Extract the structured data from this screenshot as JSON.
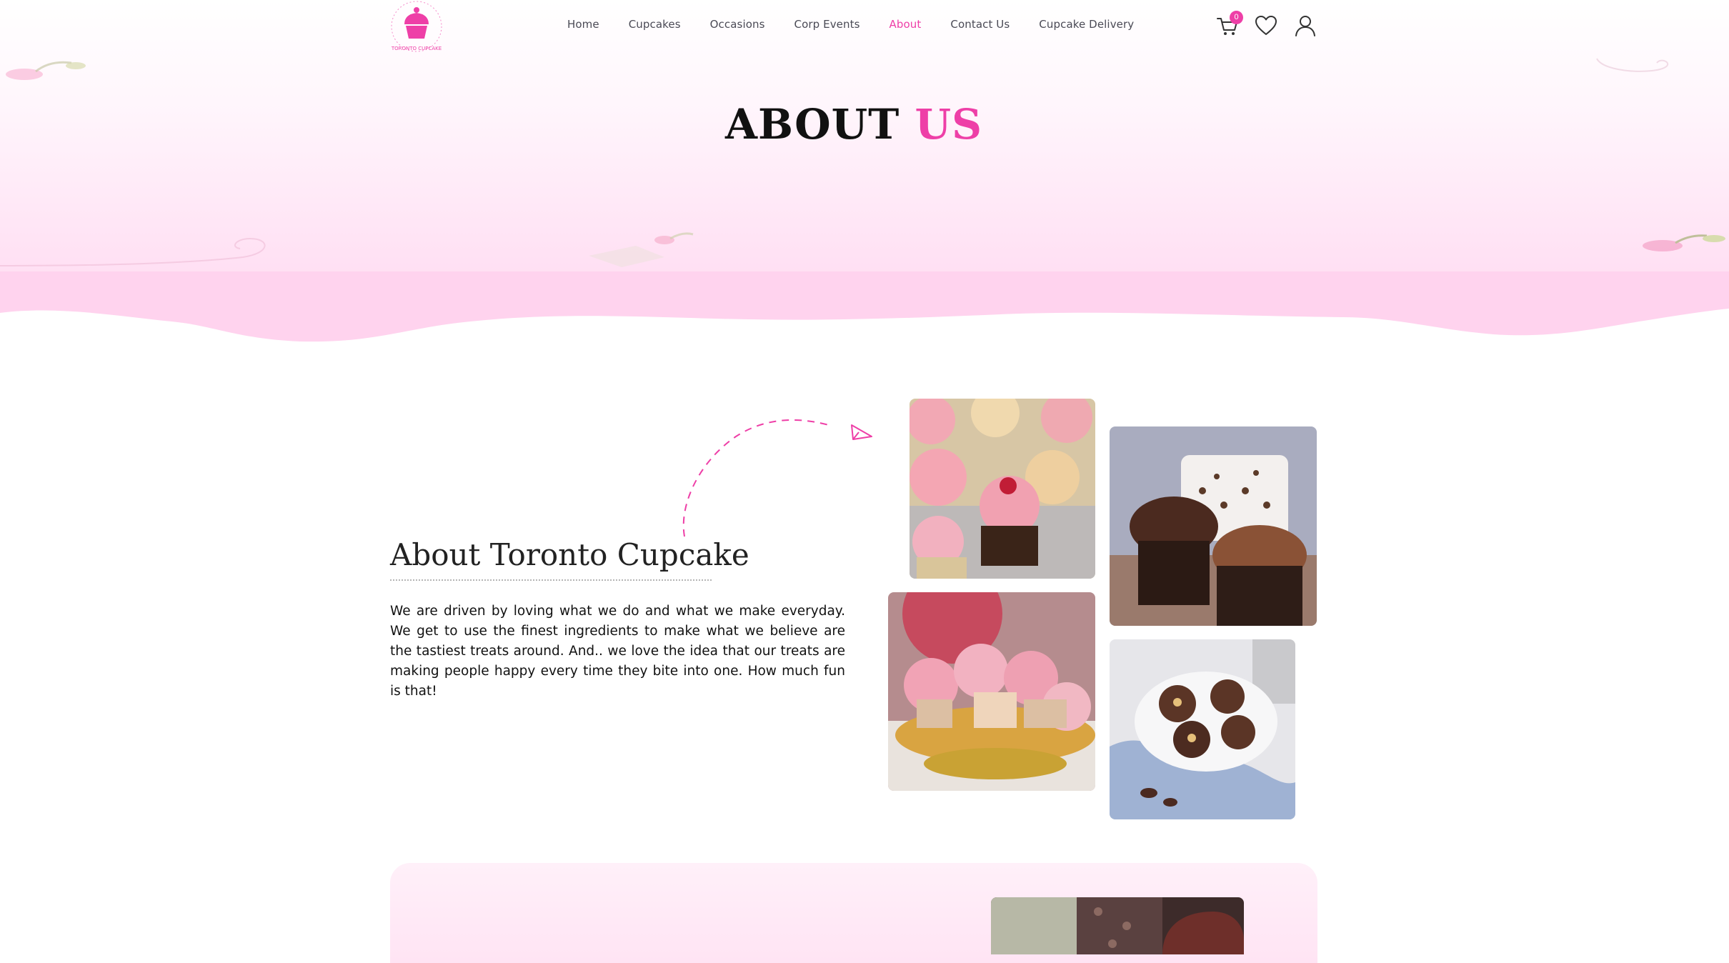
{
  "header": {
    "logo_text": "TORONTO CUPCAKE",
    "nav": [
      {
        "label": "Home",
        "active": false
      },
      {
        "label": "Cupcakes",
        "active": false
      },
      {
        "label": "Occasions",
        "active": false
      },
      {
        "label": "Corp Events",
        "active": false
      },
      {
        "label": "About",
        "active": true
      },
      {
        "label": "Contact Us",
        "active": false
      },
      {
        "label": "Cupcake Delivery",
        "active": false
      }
    ],
    "cart_count": "0",
    "icons": [
      "cart-icon",
      "heart-icon",
      "user-icon"
    ]
  },
  "hero": {
    "title_main": "ABOUT",
    "title_accent": "US"
  },
  "about": {
    "heading": "About Toronto Cupcake",
    "body": "We are driven by loving what we do and what we make everyday. We get to use the finest ingredients to make what we believe are the tastiest treats around. And.. we love the idea that our treats are making people happy every time they bite into one. How much fun is that!"
  },
  "colors": {
    "accent": "#ee3fa7",
    "hero_pink": "#ffd6ef",
    "text": "#111111",
    "nav_text": "#4a4a55"
  }
}
